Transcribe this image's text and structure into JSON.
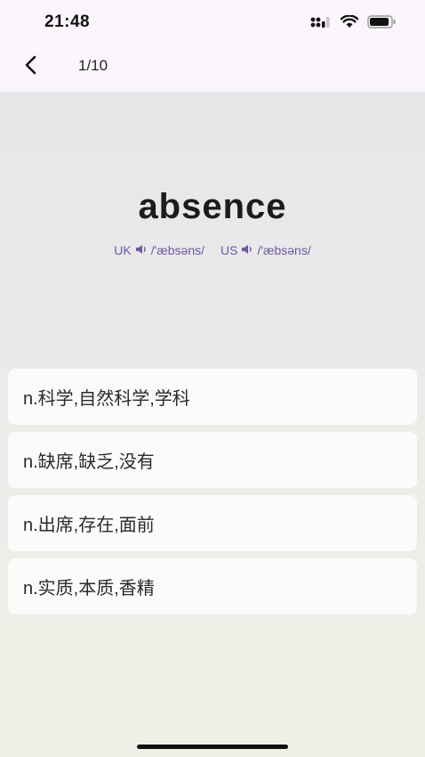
{
  "status_bar": {
    "time": "21:48",
    "icons": [
      "cellular-signal-icon",
      "wifi-icon",
      "battery-icon"
    ]
  },
  "nav": {
    "back_icon": "chevron-left-icon",
    "progress": "1/10"
  },
  "word": {
    "text": "absence",
    "phonetics": [
      {
        "region": "UK",
        "icon": "speaker-icon",
        "ipa": "/'æbsəns/"
      },
      {
        "region": "US",
        "icon": "speaker-icon",
        "ipa": "/'æbsəns/"
      }
    ]
  },
  "options": [
    {
      "text": "n.科学,自然科学,学科"
    },
    {
      "text": "n.缺席,缺乏,没有"
    },
    {
      "text": "n.出席,存在,面前"
    },
    {
      "text": "n.实质,本质,香精"
    }
  ],
  "colors": {
    "phonetic_accent": "#6b5aa3",
    "header_bg": "#fbf6fc",
    "card_bg": "#fbfbfb"
  }
}
